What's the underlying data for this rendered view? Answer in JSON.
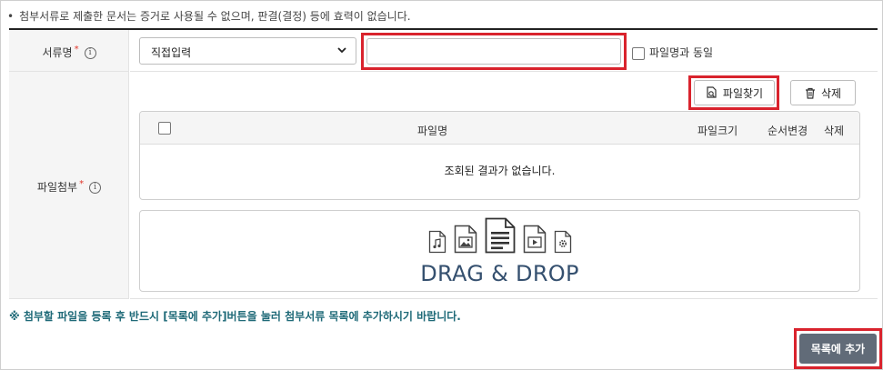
{
  "notice": {
    "bullet": "•",
    "text": "첨부서류로 제출한 문서는 증거로 사용될 수 없으며, 판결(결정) 등에 효력이 없습니다."
  },
  "doc_name_row": {
    "label": "서류명",
    "required_mark": "*",
    "info_icon": "i",
    "select": {
      "value": "직접입력",
      "icon": "chevron-down-icon"
    },
    "name_input": {
      "value": "",
      "placeholder": ""
    },
    "same_as_filename": {
      "label": "파일명과 동일",
      "checked": false
    }
  },
  "attach_row": {
    "label": "파일첨부",
    "required_mark": "*",
    "info_icon": "i",
    "find_button": {
      "label": "파일찾기",
      "icon": "file-search-icon"
    },
    "delete_button": {
      "label": "삭제",
      "icon": "trash-icon"
    },
    "grid": {
      "columns": [
        "파일명",
        "파일크기",
        "순서변경",
        "삭제"
      ],
      "empty_message": "조회된 결과가 없습니다."
    },
    "dropzone": {
      "text": "DRAG & DROP",
      "icons": [
        "audio-file-icon",
        "image-file-icon",
        "document-file-icon",
        "video-file-icon",
        "settings-file-icon"
      ]
    }
  },
  "guide_text": "※ 첨부할 파일을 등록 후 반드시 [목록에 추가]버튼을 눌러 첨부서류 목록에 추가하시기 바랍니다.",
  "add_button": {
    "label": "목록에 추가"
  },
  "colors": {
    "highlight": "#d9232d",
    "primary_button": "#616b78",
    "required": "#e0362b",
    "guide": "#1f6a78",
    "dropzone_text": "#35506f"
  }
}
